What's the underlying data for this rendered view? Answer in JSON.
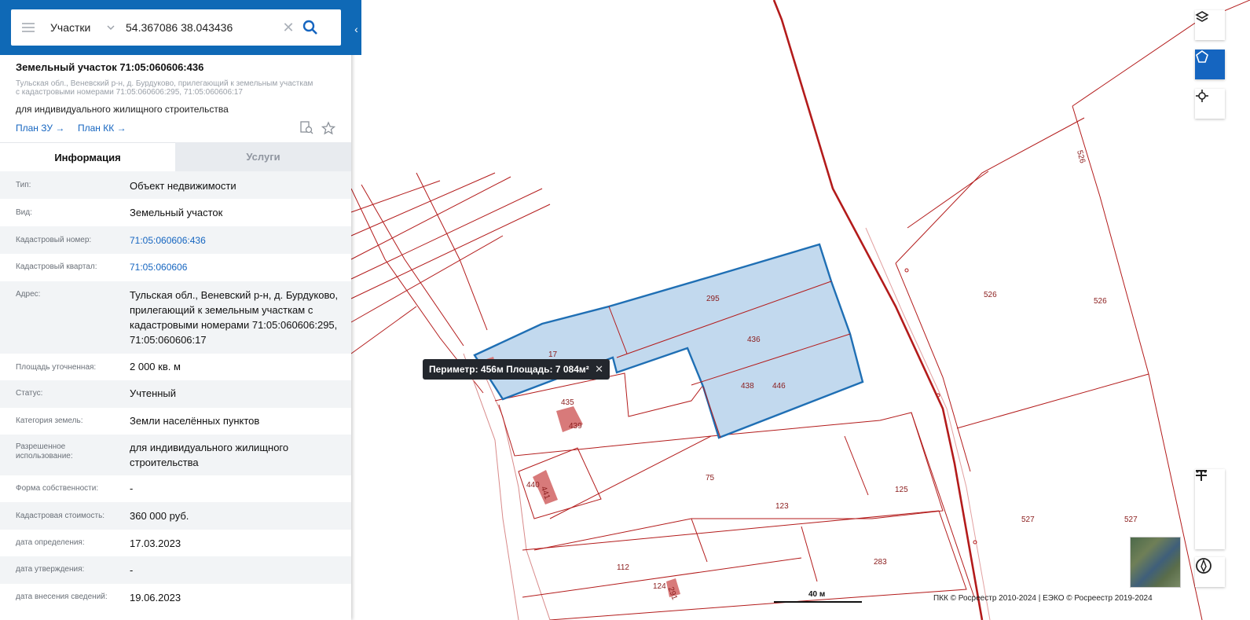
{
  "search": {
    "layer": "Участки",
    "value": "54.367086 38.043436"
  },
  "card": {
    "title": "Земельный участок 71:05:060606:436",
    "address": "Тульская обл., Веневский р-н, д. Бурдуково, прилегающий к земельным участкам с кадастровыми номерами 71:05:060606:295, 71:05:060606:17",
    "use": "для индивидуального жилищного строительства",
    "plan_zu": "План ЗУ →",
    "plan_kk": "План КК →"
  },
  "tabs": {
    "info": "Информация",
    "services": "Услуги"
  },
  "fields": [
    {
      "key": "Тип:",
      "value": "Объект недвижимости"
    },
    {
      "key": "Вид:",
      "value": "Земельный участок"
    },
    {
      "key": "Кадастровый номер:",
      "value": "71:05:060606:436"
    },
    {
      "key": "Кадастровый квартал:",
      "value": "71:05:060606"
    },
    {
      "key": "Адрес:",
      "value": "Тульская обл., Веневский р-н, д. Бурдуково, прилегающий к земельным участкам с кадастровыми номерами 71:05:060606:295, 71:05:060606:17"
    },
    {
      "key": "Площадь уточненная:",
      "value": "2 000 кв. м"
    },
    {
      "key": "Статус:",
      "value": "Учтенный"
    },
    {
      "key": "Категория земель:",
      "value": "Земли населённых пунктов"
    },
    {
      "key": "Разрешенное использование:",
      "value": "для индивидуального жилищного строительства"
    },
    {
      "key": "Форма собственности:",
      "value": "-"
    },
    {
      "key": "Кадастровая стоимость:",
      "value": "360 000 руб."
    },
    {
      "key": "дата определения:",
      "value": "17.03.2023"
    },
    {
      "key": "дата утверждения:",
      "value": "-"
    },
    {
      "key": "дата внесения сведений:",
      "value": "19.06.2023"
    }
  ],
  "map": {
    "measure": "Периметр: 456м Площадь: 7 084м²",
    "scale": "40 м",
    "attribution": "ПКК © Росреестр 2010-2024 | ЕЭКО © Росреестр 2019-2024",
    "parcel_labels": [
      "295",
      "436",
      "17",
      "438",
      "446",
      "435",
      "439",
      "440",
      "441",
      "75",
      "123",
      "125",
      "112",
      "124",
      "291",
      "283",
      "526",
      "526",
      "526",
      "527",
      "527"
    ],
    "colors": {
      "boundary": "#b31b1b",
      "selection_fill": "#c2d9ee",
      "selection_stroke": "#1f6fb4",
      "building": "#d87a7a",
      "panel_blue": "#0f69b6"
    }
  }
}
